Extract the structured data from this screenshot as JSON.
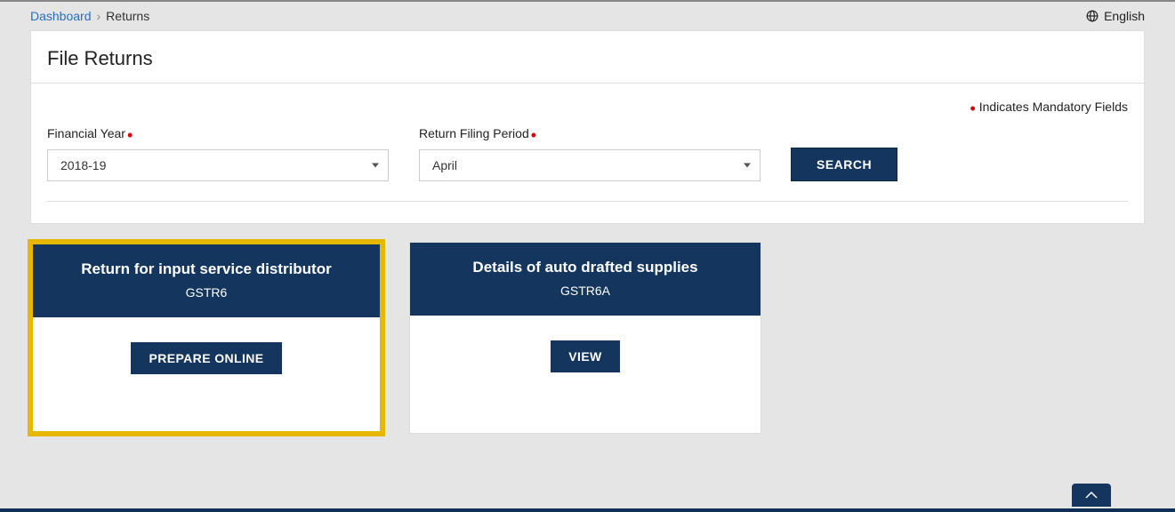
{
  "breadcrumb": {
    "root": "Dashboard",
    "current": "Returns"
  },
  "language": "English",
  "panel": {
    "title": "File Returns",
    "mandatory_note": "Indicates Mandatory Fields",
    "fields": {
      "financial_year": {
        "label": "Financial Year",
        "value": "2018-19"
      },
      "return_period": {
        "label": "Return Filing Period",
        "value": "April"
      }
    },
    "search_label": "SEARCH"
  },
  "cards": [
    {
      "title": "Return for input service distributor",
      "code": "GSTR6",
      "action": "PREPARE ONLINE",
      "highlighted": true
    },
    {
      "title": "Details of auto drafted supplies",
      "code": "GSTR6A",
      "action": "VIEW",
      "highlighted": false
    }
  ]
}
